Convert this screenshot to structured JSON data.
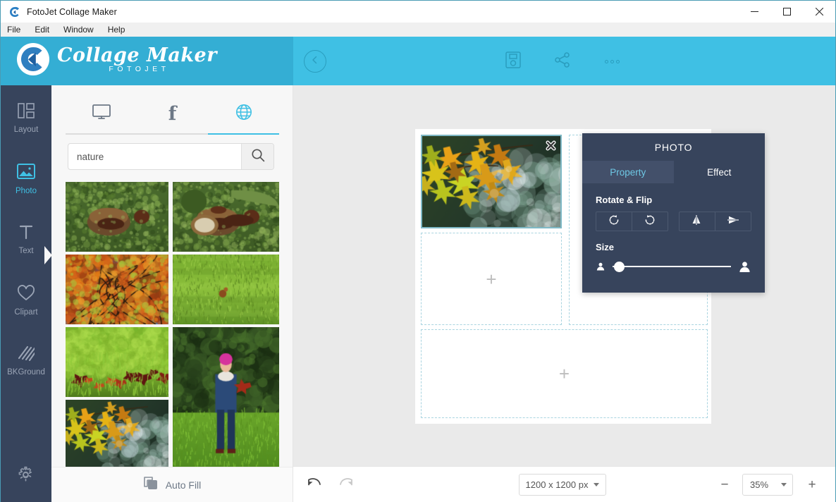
{
  "window": {
    "title": "FotoJet Collage Maker",
    "app_icon": "fotojet-logo-icon",
    "controls": [
      {
        "name": "minimize",
        "icon": "minimize-icon"
      },
      {
        "name": "maximize",
        "icon": "maximize-icon"
      },
      {
        "name": "close",
        "icon": "close-icon"
      }
    ]
  },
  "menubar": {
    "items": [
      {
        "label": "File"
      },
      {
        "label": "Edit"
      },
      {
        "label": "Window"
      },
      {
        "label": "Help"
      }
    ]
  },
  "brand": {
    "main": "Collage Maker",
    "sub": "FOTOJET",
    "logo_icon": "collage-maker-logo-icon",
    "background_color": "#34aed4"
  },
  "canvas_toolbar": {
    "background_color": "#3fc0e4",
    "back_icon": "chevron-left-circle-icon",
    "buttons": [
      {
        "name": "save",
        "icon": "save-disk-icon"
      },
      {
        "name": "share",
        "icon": "share-nodes-icon"
      },
      {
        "name": "more",
        "icon": "more-dots-icon"
      }
    ]
  },
  "sidebar": {
    "background_color": "#37445c",
    "active_color": "#3fc0e4",
    "items": [
      {
        "label": "Layout",
        "icon": "layout-grid-icon",
        "active": false
      },
      {
        "label": "Photo",
        "icon": "photo-image-icon",
        "active": true
      },
      {
        "label": "Text",
        "icon": "text-t-icon",
        "active": false
      },
      {
        "label": "Clipart",
        "icon": "heart-icon",
        "active": false
      },
      {
        "label": "BKGround",
        "icon": "diagonal-stripes-icon",
        "active": false
      }
    ],
    "settings": {
      "name": "settings",
      "icon": "gear-icon"
    }
  },
  "panel": {
    "tabs": [
      {
        "name": "computer",
        "icon": "monitor-icon",
        "active": false
      },
      {
        "name": "facebook",
        "icon": "facebook-f-icon",
        "label": "f",
        "active": false
      },
      {
        "name": "web",
        "icon": "globe-icon",
        "active": true
      }
    ],
    "search": {
      "value": "nature",
      "placeholder": "Search",
      "button_icon": "search-icon"
    },
    "thumbnails": [
      {
        "name": "thumb-chestnuts-moss-1",
        "alt": "chestnuts in green moss"
      },
      {
        "name": "thumb-chestnuts-moss-2",
        "alt": "opened chestnut shells on moss"
      },
      {
        "name": "thumb-autumn-foliage",
        "alt": "red and orange autumn tree leaves"
      },
      {
        "name": "thumb-green-grass-squirrel",
        "alt": "squirrel on sunlit green lawn"
      },
      {
        "name": "thumb-red-leaves-grass",
        "alt": "dark red maple leaves on green grass"
      },
      {
        "name": "thumb-child-park",
        "alt": "child in denim jacket and pink hat holding red leaves"
      },
      {
        "name": "thumb-yellow-maple-bokeh",
        "alt": "yellow maple leaves with bokeh background"
      }
    ],
    "footer": {
      "auto_fill_label": "Auto Fill",
      "auto_fill_icon": "copy-stack-icon"
    }
  },
  "canvas": {
    "background_color": "#eaeaea",
    "page_background": "#ffffff",
    "cells": [
      {
        "name": "photo-cell-filled",
        "filled": true,
        "alt": "yellow maple leaves backlit with bokeh",
        "close_icon": "close-x-icon"
      },
      {
        "name": "empty-cell-right-top",
        "filled": false,
        "placeholder": "+"
      },
      {
        "name": "empty-cell-left-middle",
        "filled": false,
        "placeholder": "+"
      },
      {
        "name": "empty-cell-bottom",
        "filled": false,
        "placeholder": "+"
      }
    ]
  },
  "photo_popup": {
    "title": "PHOTO",
    "tabs": [
      {
        "label": "Property",
        "active": true
      },
      {
        "label": "Effect",
        "active": false
      }
    ],
    "rotate_flip": {
      "label": "Rotate & Flip",
      "buttons": [
        {
          "name": "rotate-left",
          "icon": "rotate-counterclockwise-icon"
        },
        {
          "name": "rotate-right",
          "icon": "rotate-clockwise-icon"
        },
        {
          "name": "flip-horizontal",
          "icon": "flip-horizontal-icon"
        },
        {
          "name": "flip-vertical",
          "icon": "flip-vertical-icon"
        }
      ]
    },
    "size": {
      "label": "Size",
      "min_icon": "person-small-icon",
      "max_icon": "person-large-icon",
      "value_percent": 6
    },
    "background_color": "#37445c"
  },
  "bottombar": {
    "undo": {
      "name": "undo",
      "icon": "undo-arrow-icon",
      "enabled": true
    },
    "redo": {
      "name": "redo",
      "icon": "redo-arrow-icon",
      "enabled": false
    },
    "canvas_size": {
      "value": "1200 x 1200 px",
      "caret_icon": "chevron-down-icon"
    },
    "zoom_out_label": "−",
    "zoom": {
      "value": "35%",
      "caret_icon": "chevron-down-icon"
    },
    "zoom_in_label": "+"
  }
}
